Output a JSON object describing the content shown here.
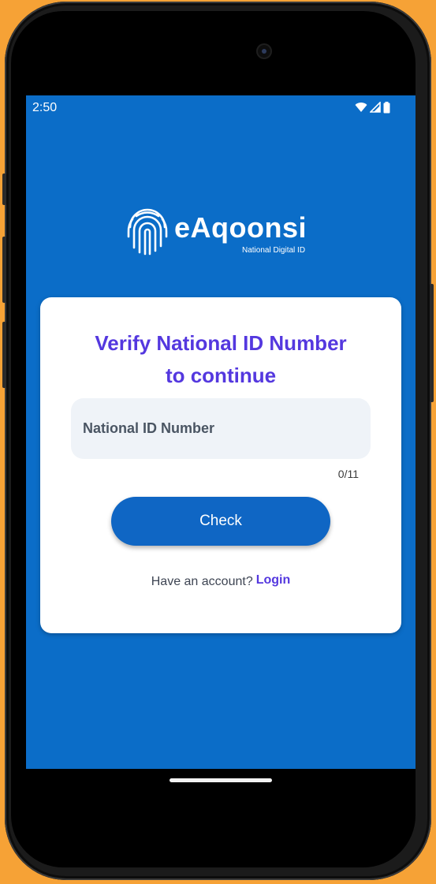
{
  "status_bar": {
    "time": "2:50",
    "icons": [
      "wifi-icon",
      "signal-icon",
      "battery-icon"
    ]
  },
  "logo": {
    "name": "eAqoonsi",
    "tagline": "National Digital ID",
    "icon": "fingerprint-icon"
  },
  "card": {
    "title_line1": "Verify National ID Number",
    "title_line2": "to continue",
    "field": {
      "placeholder": "National ID Number",
      "value": "",
      "counter": "0/11"
    },
    "check_label": "Check",
    "account_prompt": "Have an account?",
    "login_label": "Login"
  },
  "colors": {
    "background": "#0B6DC8",
    "accent": "#5438DF",
    "button": "#0F66C4",
    "field_bg": "#EFF3F8",
    "device_frame_bg": "#F6A236"
  }
}
